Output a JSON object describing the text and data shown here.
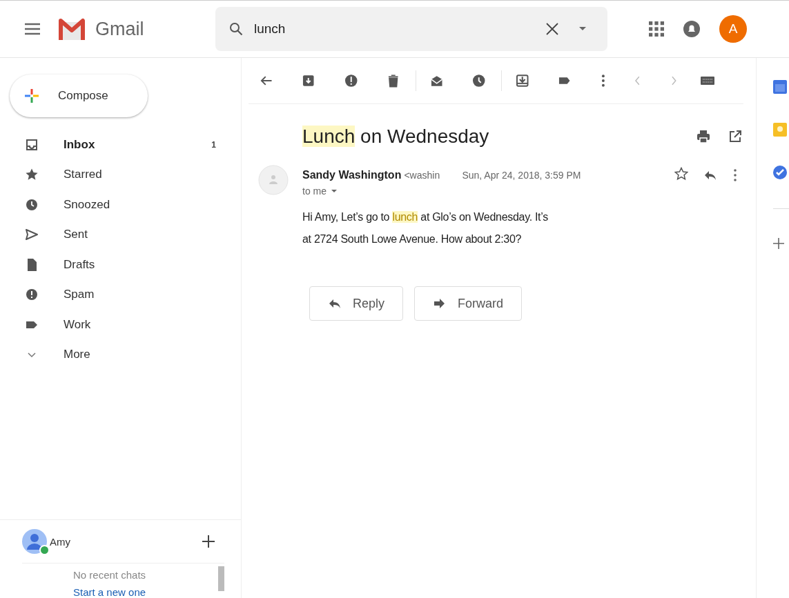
{
  "header": {
    "app_name": "Gmail",
    "search": {
      "value": "lunch"
    },
    "account_initial": "A"
  },
  "compose": {
    "label": "Compose"
  },
  "nav": [
    {
      "label": "Inbox",
      "count": "1",
      "selected": true
    },
    {
      "label": "Starred",
      "selected": false
    },
    {
      "label": "Snoozed",
      "selected": false
    },
    {
      "label": "Sent",
      "selected": false
    },
    {
      "label": "Drafts",
      "selected": false
    },
    {
      "label": "Spam",
      "selected": false
    },
    {
      "label": "Work",
      "selected": false
    },
    {
      "label": "More",
      "selected": false
    }
  ],
  "chat": {
    "user": "Amy",
    "online": true,
    "empty_text": "No recent chats",
    "link": "Start a new one"
  },
  "message": {
    "subject": [
      {
        "text": "Lunch",
        "highlight": true
      },
      {
        "text": " on Wednesday",
        "highlight": false
      }
    ],
    "sender": "Sandy Washington",
    "email": "<washin",
    "date": "Sun, Apr 24, 2018, 3:59 PM",
    "starred": false,
    "recipient": "to me",
    "body": [
      [
        {
          "text": "Hi Amy, Let’s go to ",
          "highlight": false
        },
        {
          "text": "lunch",
          "highlight": true
        },
        {
          "text": " at Glo’s on Wednesday. It’s",
          "highlight": false
        }
      ],
      [
        {
          "text": " at 2724 South Lowe Avenue. How about 2:30?",
          "highlight": false
        }
      ]
    ],
    "actions": [
      {
        "label": "Reply",
        "kind": "reply"
      },
      {
        "label": "Forward",
        "kind": "forward"
      }
    ]
  }
}
